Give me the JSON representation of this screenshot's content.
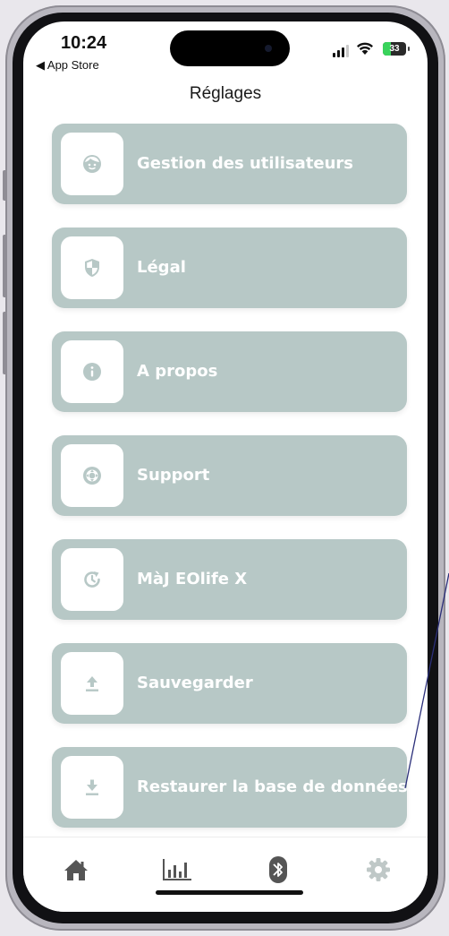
{
  "status_bar": {
    "time": "10:24",
    "back_app": "◀ App Store",
    "battery": "33"
  },
  "header": {
    "title": "Réglages"
  },
  "menu": [
    {
      "label": "Gestion des utilisateurs",
      "icon": "user-face-icon"
    },
    {
      "label": "Légal",
      "icon": "shield-icon"
    },
    {
      "label": "A propos",
      "icon": "info-icon"
    },
    {
      "label": "Support",
      "icon": "lifebuoy-icon"
    },
    {
      "label": "MàJ EOlife X",
      "icon": "update-icon"
    },
    {
      "label": "Sauvegarder",
      "icon": "upload-icon"
    },
    {
      "label": "Restaurer la base de données",
      "icon": "download-icon"
    }
  ],
  "tabs": [
    {
      "name": "home",
      "icon": "home-icon",
      "active": false
    },
    {
      "name": "stats",
      "icon": "bar-chart-icon",
      "active": false
    },
    {
      "name": "bluetooth",
      "icon": "bluetooth-icon",
      "active": false
    },
    {
      "name": "settings",
      "icon": "gear-icon",
      "active": true
    }
  ],
  "colors": {
    "card_bg": "#b7c8c6",
    "icon_color": "#b7c8c6",
    "tab_icon": "#555555",
    "tab_active": "#bfc8c7",
    "annotation_line": "#2b2f7a"
  }
}
